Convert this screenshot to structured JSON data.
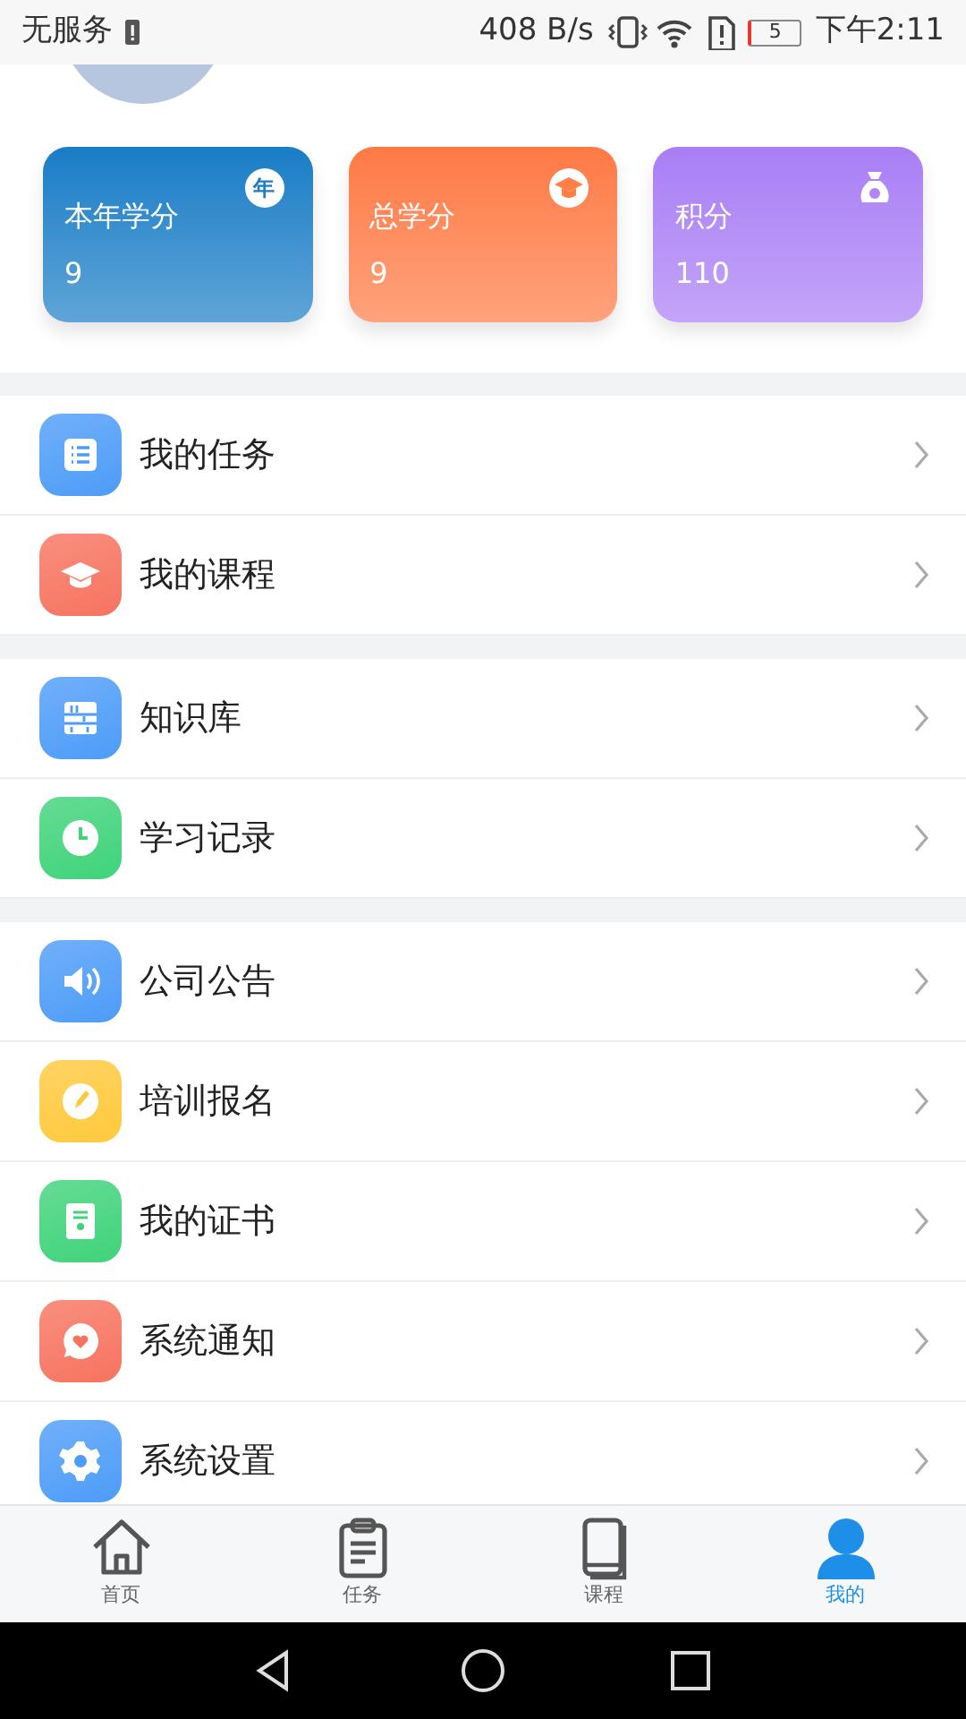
{
  "status_bar": {
    "carrier": "无服务",
    "speed": "408 B/s",
    "battery": "5",
    "time": "下午2:11"
  },
  "stats": [
    {
      "label": "本年学分",
      "value": "9",
      "kind": "year",
      "badge": "年",
      "color": "#1a7dc6"
    },
    {
      "label": "总学分",
      "value": "9",
      "kind": "cap",
      "color": "#ff7a45"
    },
    {
      "label": "积分",
      "value": "110",
      "kind": "bag",
      "color": "#a97ef5"
    }
  ],
  "menu_groups": [
    [
      {
        "label": "我的任务",
        "kind": "list",
        "color": "#4d9cf8"
      },
      {
        "label": "我的课程",
        "kind": "cap",
        "color": "#f7735f"
      }
    ],
    [
      {
        "label": "知识库",
        "kind": "shelf",
        "color": "#4d9cf8"
      },
      {
        "label": "学习记录",
        "kind": "clock",
        "color": "#3fd37a"
      }
    ],
    [
      {
        "label": "公司公告",
        "kind": "speaker",
        "color": "#4d9cf8"
      },
      {
        "label": "培训报名",
        "kind": "pen",
        "color": "#ffc93c"
      },
      {
        "label": "我的证书",
        "kind": "cert",
        "color": "#3fd37a"
      },
      {
        "label": "系统通知",
        "kind": "chat",
        "color": "#f7735f"
      },
      {
        "label": "系统设置",
        "kind": "gear",
        "color": "#4d9cf8"
      }
    ]
  ],
  "tabs": [
    {
      "label": "首页",
      "kind": "home",
      "selected": false
    },
    {
      "label": "任务",
      "kind": "clipboard",
      "selected": false
    },
    {
      "label": "课程",
      "kind": "book",
      "selected": false
    },
    {
      "label": "我的",
      "kind": "person",
      "selected": true
    }
  ]
}
